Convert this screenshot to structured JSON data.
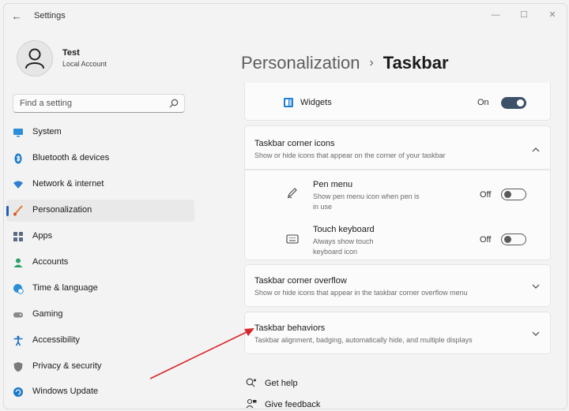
{
  "app": {
    "title": "Settings"
  },
  "user": {
    "name": "Test",
    "account_type": "Local Account"
  },
  "search": {
    "placeholder": "Find a setting"
  },
  "sidebar": {
    "items": [
      {
        "label": "System",
        "icon": "monitor-icon",
        "active": false
      },
      {
        "label": "Bluetooth & devices",
        "icon": "bluetooth-icon",
        "active": false
      },
      {
        "label": "Network & internet",
        "icon": "wifi-icon",
        "active": false
      },
      {
        "label": "Personalization",
        "icon": "brush-icon",
        "active": true
      },
      {
        "label": "Apps",
        "icon": "apps-icon",
        "active": false
      },
      {
        "label": "Accounts",
        "icon": "person-icon",
        "active": false
      },
      {
        "label": "Time & language",
        "icon": "globe-clock-icon",
        "active": false
      },
      {
        "label": "Gaming",
        "icon": "gamepad-icon",
        "active": false
      },
      {
        "label": "Accessibility",
        "icon": "accessibility-icon",
        "active": false
      },
      {
        "label": "Privacy & security",
        "icon": "shield-icon",
        "active": false
      },
      {
        "label": "Windows Update",
        "icon": "update-icon",
        "active": false
      }
    ]
  },
  "breadcrumb": {
    "parent": "Personalization",
    "separator": "›",
    "current": "Taskbar"
  },
  "widgets_row": {
    "label": "Widgets",
    "state": "On"
  },
  "corner_icons": {
    "title": "Taskbar corner icons",
    "desc": "Show or hide icons that appear on the corner of your taskbar",
    "pen_menu": {
      "title": "Pen menu",
      "desc": "Show pen menu icon when pen is in use",
      "state": "Off"
    },
    "touch_keyboard": {
      "title": "Touch keyboard",
      "desc": "Always show touch keyboard icon",
      "state": "Off"
    }
  },
  "corner_overflow": {
    "title": "Taskbar corner overflow",
    "desc": "Show or hide icons that appear in the taskbar corner overflow menu"
  },
  "behaviors": {
    "title": "Taskbar behaviors",
    "desc": "Taskbar alignment, badging, automatically hide, and multiple displays"
  },
  "links": {
    "help": "Get help",
    "feedback": "Give feedback"
  },
  "colors": {
    "accent": "#1f5fb8",
    "toggle_on": "#3c5068",
    "arrow": "#d9262b"
  }
}
